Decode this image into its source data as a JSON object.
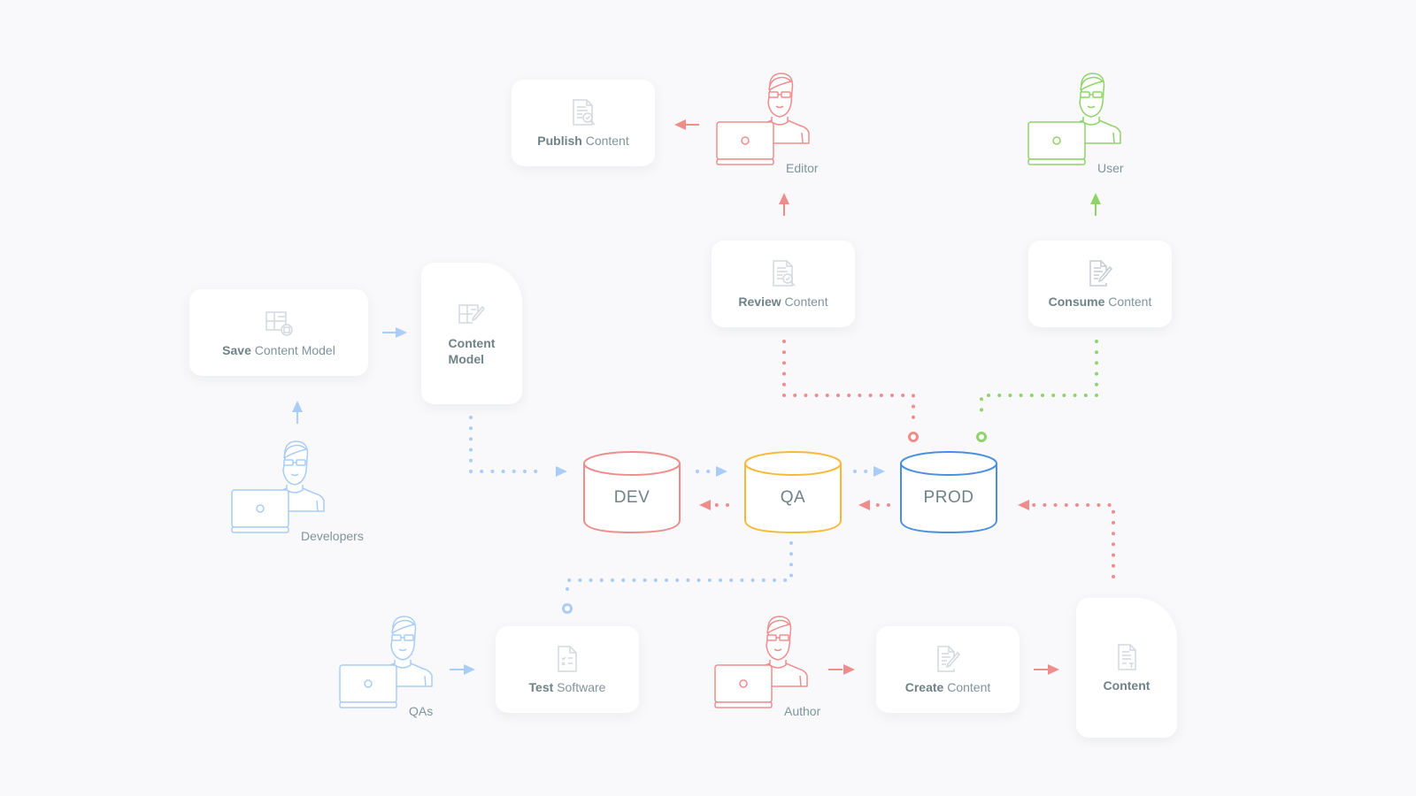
{
  "colors": {
    "background": "#f9f9fb",
    "blue": "#a9cdf6",
    "red": "#ef8d8d",
    "green": "#8fd46a",
    "yellow": "#f7b93a",
    "prod_blue": "#4a8fe0",
    "text": "#7f949c",
    "icon_gray": "#d3d8dd"
  },
  "cards": {
    "publish": {
      "bold": "Publish",
      "rest": " Content",
      "icon": "document-search-icon"
    },
    "review": {
      "bold": "Review",
      "rest": " Content",
      "icon": "document-search-icon"
    },
    "consume": {
      "bold": "Consume",
      "rest": " Content",
      "icon": "document-edit-icon"
    },
    "save_model": {
      "bold": "Save",
      "rest": " Content Model",
      "icon": "table-save-icon"
    },
    "content_model": {
      "line1": "Content",
      "line2": "Model",
      "icon": "table-edit-icon"
    },
    "test": {
      "bold": "Test",
      "rest": " Software",
      "icon": "checklist-document-icon"
    },
    "create": {
      "bold": "Create",
      "rest": " Content",
      "icon": "document-edit-icon"
    },
    "content": {
      "bold": "Content",
      "icon": "text-document-icon"
    }
  },
  "people": {
    "editor": {
      "name": "Editor",
      "color": "#ef8d8d"
    },
    "user": {
      "name": "User",
      "color": "#8fd46a"
    },
    "developers": {
      "name": "Developers",
      "color": "#a9cdf6"
    },
    "qas": {
      "name": "QAs",
      "color": "#a9cdf6"
    },
    "author": {
      "name": "Author",
      "color": "#ef8d8d"
    }
  },
  "databases": {
    "dev": {
      "label": "DEV",
      "color": "#ef8d8d"
    },
    "qa": {
      "label": "QA",
      "color": "#f7b93a"
    },
    "prod": {
      "label": "PROD",
      "color": "#4a8fe0"
    }
  }
}
